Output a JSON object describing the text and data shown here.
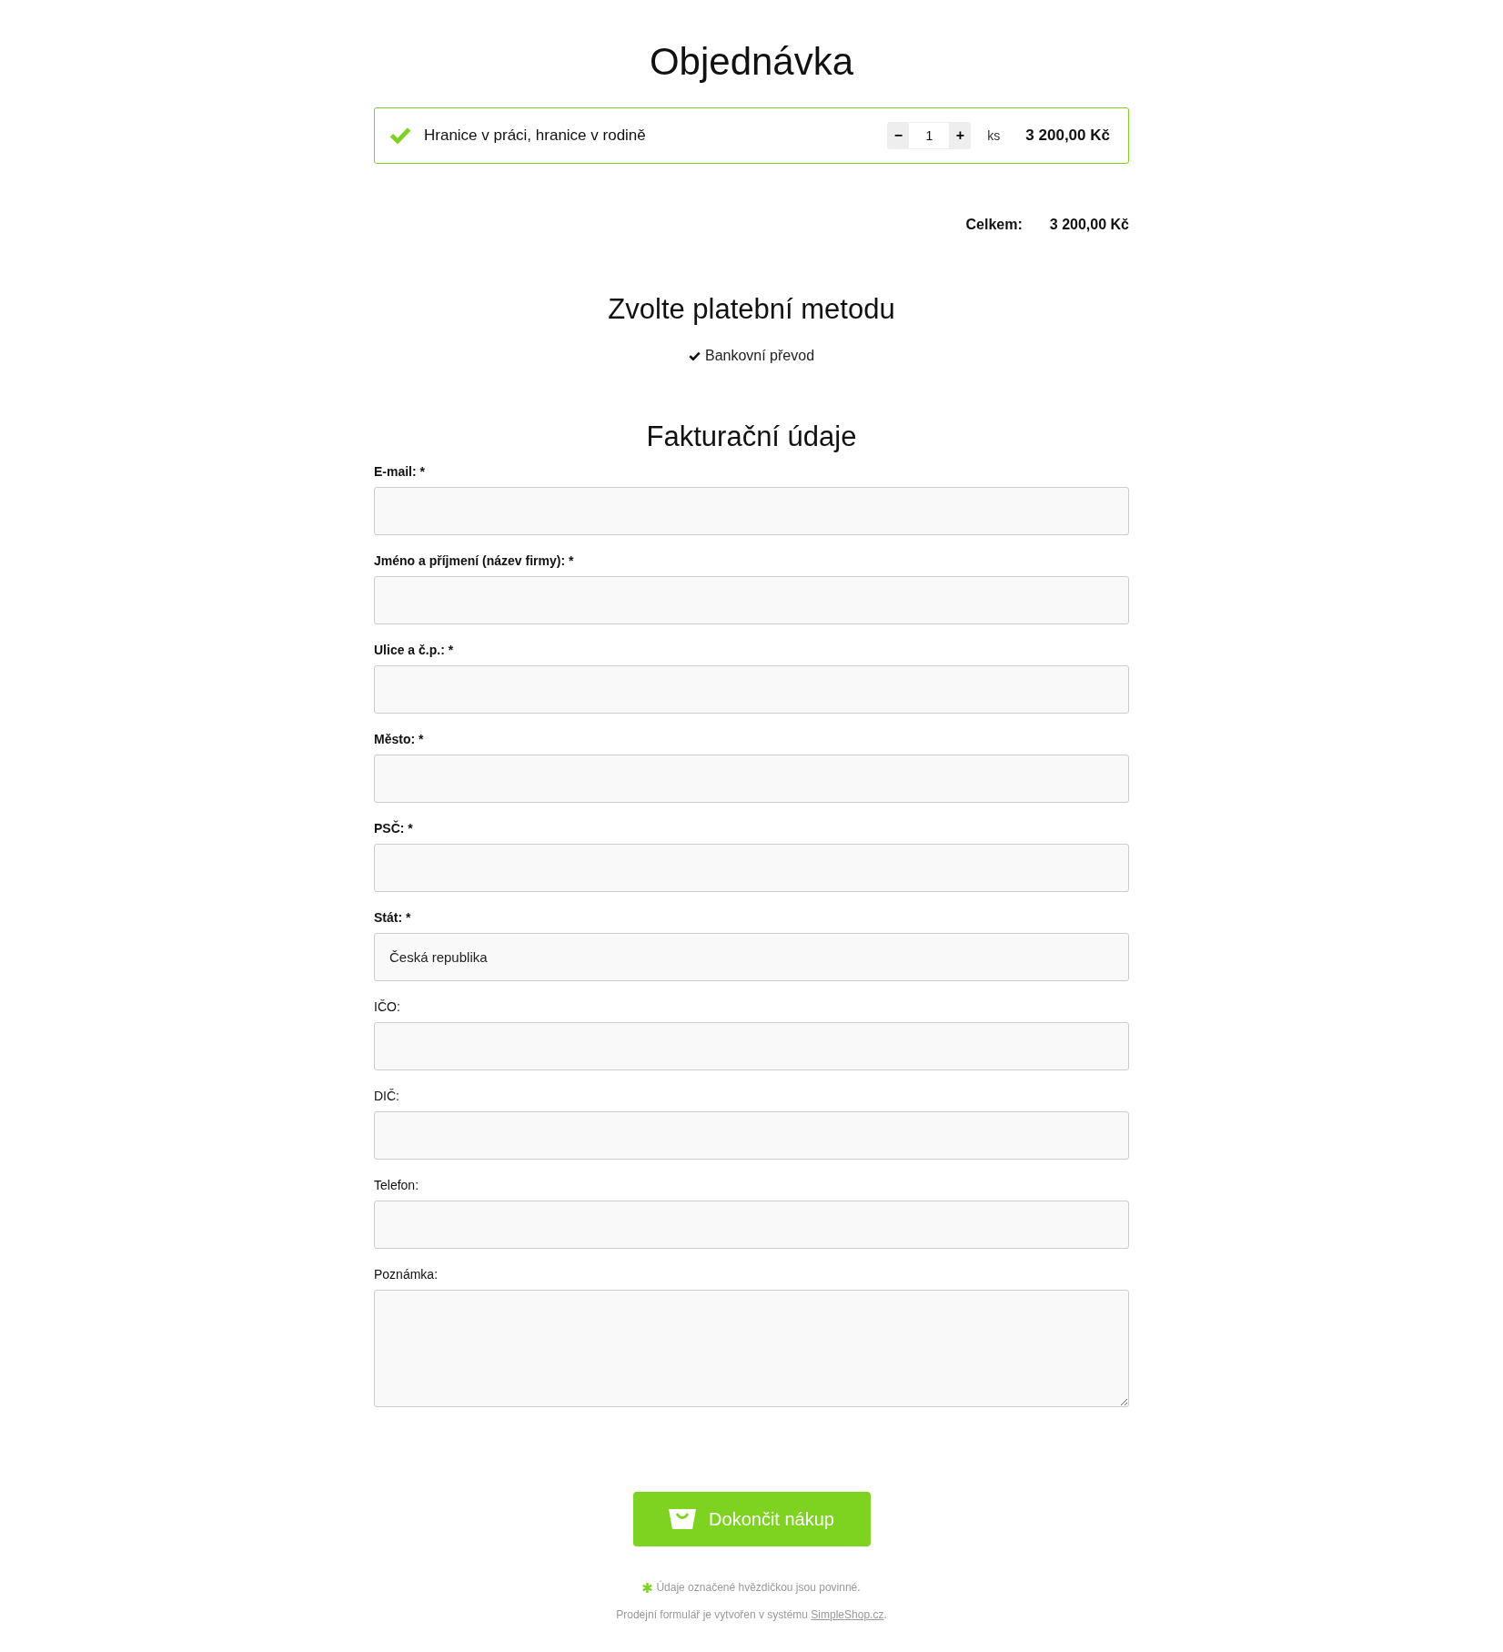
{
  "title": "Objednávka",
  "product": {
    "name": "Hranice v práci, hranice v rodině",
    "selected": true,
    "decrement": "−",
    "quantity": "1",
    "increment": "+",
    "unit": "ks",
    "price": "3 200,00 Kč"
  },
  "total": {
    "label": "Celkem:",
    "value": "3 200,00 Kč"
  },
  "payment": {
    "heading": "Zvolte platební metodu",
    "methods": [
      {
        "label": "Bankovní převod",
        "selected": true
      }
    ]
  },
  "billing": {
    "heading": "Fakturační údaje",
    "fields": [
      {
        "label": "E-mail: *",
        "required": true,
        "kind": "input"
      },
      {
        "label": "Jméno a příjmení (název firmy): *",
        "required": true,
        "kind": "input"
      },
      {
        "label": "Ulice a č.p.: *",
        "required": true,
        "kind": "input"
      },
      {
        "label": "Město: *",
        "required": true,
        "kind": "input"
      },
      {
        "label": "PSČ: *",
        "required": true,
        "kind": "input"
      },
      {
        "label": "Stát: *",
        "required": true,
        "kind": "input",
        "value": "Česká republika"
      },
      {
        "label": "IČO:",
        "required": false,
        "kind": "input"
      },
      {
        "label": "DIČ:",
        "required": false,
        "kind": "input"
      },
      {
        "label": "Telefon:",
        "required": false,
        "kind": "input"
      },
      {
        "label": "Poznámka:",
        "required": false,
        "kind": "textarea"
      }
    ]
  },
  "submit": {
    "label": "Dokončit nákup"
  },
  "footer": {
    "note": "Údaje označené hvězdičkou jsou povinné.",
    "credit_before": "Prodejní formulář je vytvořen v systému ",
    "credit_link": "SimpleShop.cz",
    "credit_after": "."
  }
}
